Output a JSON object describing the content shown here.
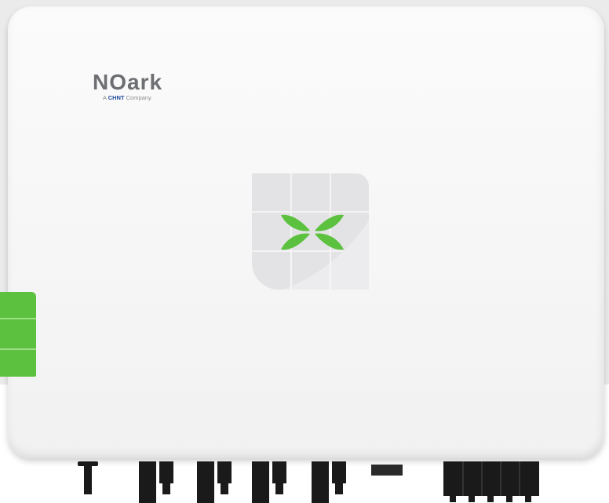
{
  "product": {
    "brand": "NOark",
    "tagline_prefix": "A",
    "tagline_brand": "CHNT",
    "tagline_suffix": "Company"
  },
  "colors": {
    "housing": "#f7f7f7",
    "logo_grey": "#6d6f73",
    "chnt_blue": "#1c4a9b",
    "status_green": "#5cc13e",
    "panel_grey": "#e3e3e5",
    "connector_black": "#1a1a1a"
  },
  "icons": {
    "status_indicator": "x-leaf-icon",
    "side_tab": "green-side-tab"
  }
}
